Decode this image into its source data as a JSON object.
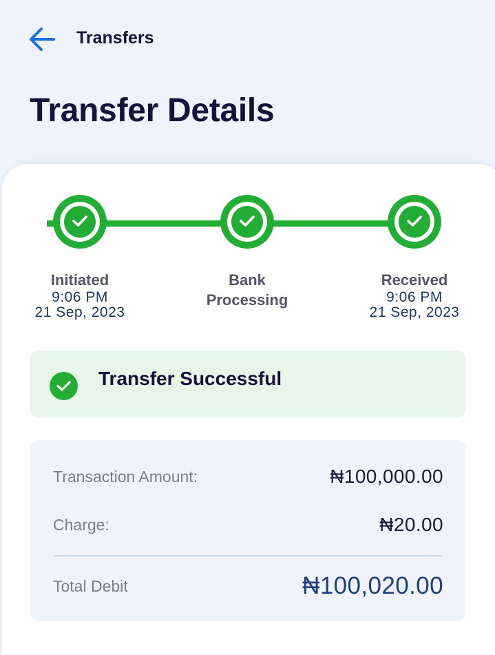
{
  "header": {
    "back_icon": "arrow-left-icon",
    "title": "Transfers"
  },
  "page_title": "Transfer Details",
  "colors": {
    "accent": "#1a6fe0",
    "success": "#24ad35",
    "success_bg": "#e8f6ea",
    "text_dark": "#17123a",
    "summary_bg": "#eff4fc",
    "total_amount": "#1d3f7a"
  },
  "stepper": {
    "steps": [
      {
        "label": "Initiated",
        "time": "9:06 PM",
        "date": "21 Sep, 2023",
        "status": "complete",
        "icon": "check-icon"
      },
      {
        "label_line1": "Bank",
        "label_line2": "Processing",
        "status": "complete",
        "icon": "check-icon"
      },
      {
        "label": "Received",
        "time": "9:06 PM",
        "date": "21 Sep, 2023",
        "status": "complete",
        "icon": "check-icon"
      }
    ]
  },
  "status_banner": {
    "icon": "check-circle-icon",
    "text": "Transfer Successful"
  },
  "summary": {
    "transaction_amount_label": "Transaction Amount:",
    "transaction_amount_value": "₦100,000.00",
    "charge_label": "Charge:",
    "charge_value": "₦20.00",
    "total_label": "Total Debit",
    "total_value": "₦100,020.00"
  }
}
